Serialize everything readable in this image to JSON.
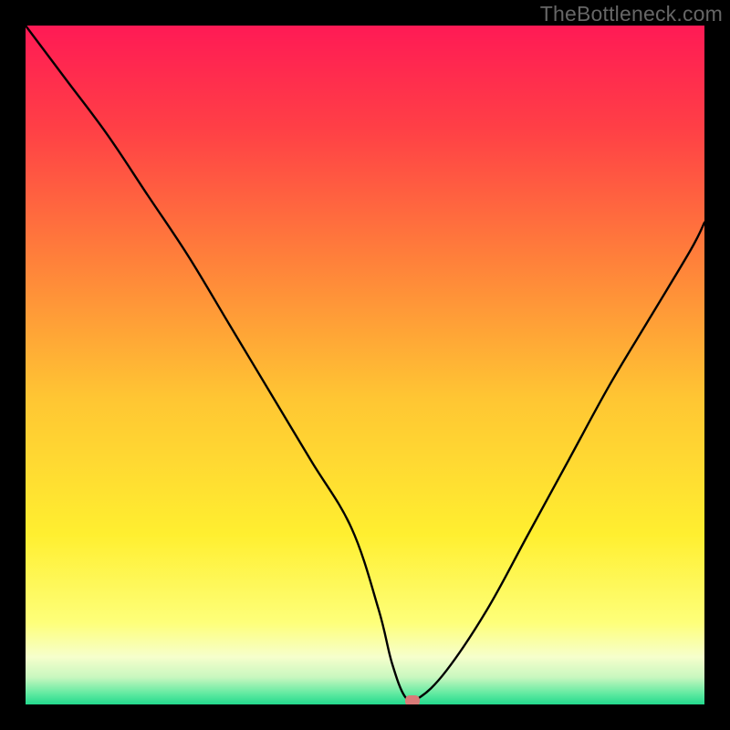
{
  "watermark": "TheBottleneck.com",
  "chart_data": {
    "type": "line",
    "title": "",
    "xlabel": "",
    "ylabel": "",
    "xlim": [
      0,
      100
    ],
    "ylim": [
      0,
      100
    ],
    "grid": false,
    "legend": false,
    "series": [
      {
        "name": "bottleneck-curve",
        "x": [
          0,
          6,
          12,
          18,
          24,
          30,
          36,
          42,
          48,
          52,
          54,
          56,
          58,
          62,
          68,
          74,
          80,
          86,
          92,
          98,
          100
        ],
        "values": [
          100,
          92,
          84,
          75,
          66,
          56,
          46,
          36,
          26,
          14,
          6,
          1,
          1,
          5,
          14,
          25,
          36,
          47,
          57,
          67,
          71
        ]
      }
    ],
    "marker": {
      "name": "optimal-point",
      "x": 57,
      "y": 0.5,
      "color": "#d97a78"
    },
    "background_gradient": {
      "type": "vertical",
      "stops": [
        {
          "pos": 0.0,
          "color": "#ff1a55"
        },
        {
          "pos": 0.15,
          "color": "#ff3f46"
        },
        {
          "pos": 0.35,
          "color": "#ff823a"
        },
        {
          "pos": 0.55,
          "color": "#ffc633"
        },
        {
          "pos": 0.75,
          "color": "#ffef30"
        },
        {
          "pos": 0.88,
          "color": "#feff7a"
        },
        {
          "pos": 0.93,
          "color": "#f6ffcc"
        },
        {
          "pos": 0.96,
          "color": "#c8f7bf"
        },
        {
          "pos": 0.985,
          "color": "#5de9a0"
        },
        {
          "pos": 1.0,
          "color": "#23d98d"
        }
      ]
    }
  }
}
